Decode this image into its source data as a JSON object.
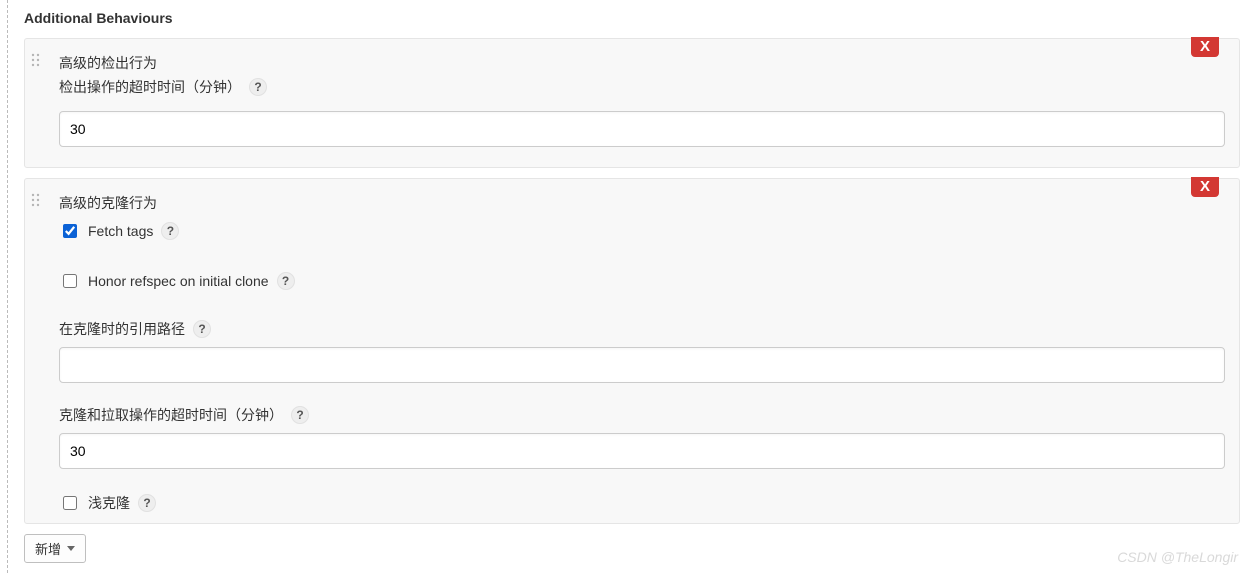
{
  "section_title": "Additional Behaviours",
  "checkout_panel": {
    "heading": "高级的检出行为",
    "timeout_label": "检出操作的超时时间（分钟）",
    "timeout_value": "30",
    "remove_label": "X",
    "help": "?"
  },
  "clone_panel": {
    "heading": "高级的克隆行为",
    "remove_label": "X",
    "fetch_tags": {
      "label": "Fetch tags",
      "checked": true,
      "help": "?"
    },
    "honor_refspec": {
      "label": "Honor refspec on initial clone",
      "checked": false,
      "help": "?"
    },
    "refpath": {
      "label": "在克隆时的引用路径",
      "value": "",
      "help": "?"
    },
    "clone_timeout": {
      "label": "克隆和拉取操作的超时时间（分钟）",
      "value": "30",
      "help": "?"
    },
    "shallow": {
      "label": "浅克隆",
      "checked": false,
      "help": "?"
    }
  },
  "add_button_label": "新增",
  "watermark": "CSDN @TheLongir"
}
